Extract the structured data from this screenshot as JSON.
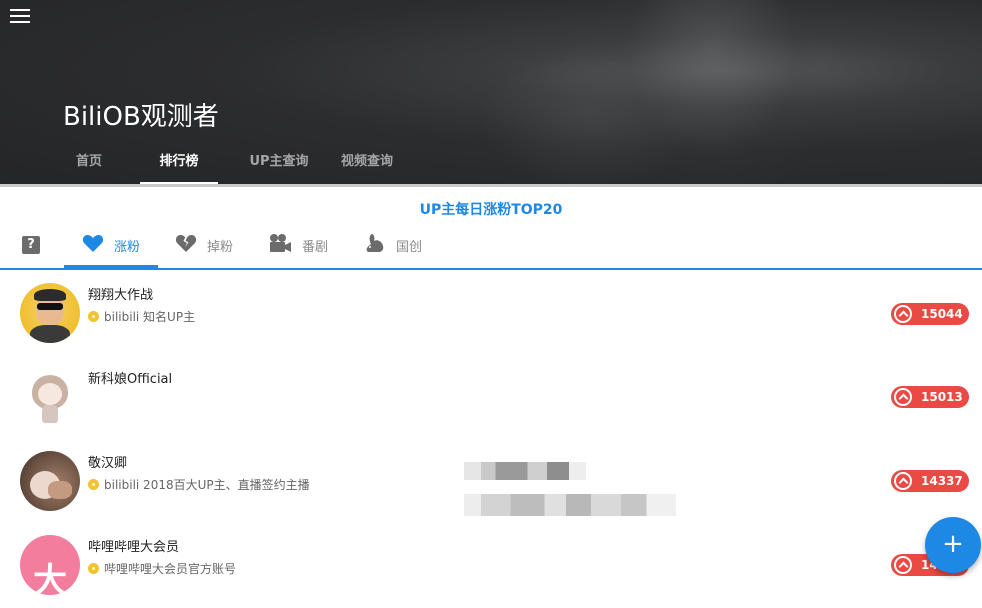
{
  "header": {
    "menu_icon": "menu-icon",
    "title": "BiliOB观测者",
    "nav": [
      {
        "label": "首页",
        "active": false
      },
      {
        "label": "排行榜",
        "active": true
      },
      {
        "label": "UP主查询",
        "active": false
      },
      {
        "label": "视频查询",
        "active": false
      }
    ]
  },
  "section_title": "UP主每日涨粉TOP20",
  "category_tabs": [
    {
      "icon": "help-icon",
      "label": "",
      "active": false
    },
    {
      "icon": "heart-icon",
      "label": "涨粉",
      "active": true
    },
    {
      "icon": "broken-heart-icon",
      "label": "掉粉",
      "active": false
    },
    {
      "icon": "video-camera-icon",
      "label": "番剧",
      "active": false
    },
    {
      "icon": "rabbit-icon",
      "label": "国创",
      "active": false
    }
  ],
  "ranking": [
    {
      "name": "翔翔大作战",
      "verified_text": "bilibili 知名UP主",
      "fans_gain": "15044"
    },
    {
      "name": "新科娘Official",
      "verified_text": "",
      "fans_gain": "15013"
    },
    {
      "name": "敬汉卿",
      "verified_text": "bilibili 2018百大UP主、直播签约主播",
      "fans_gain": "14337"
    },
    {
      "name": "哔哩哔哩大会员",
      "verified_text": "哔哩哔哩大会员官方账号",
      "fans_gain": "14..."
    }
  ],
  "fab": {
    "label": "+",
    "icon": "plus-icon"
  },
  "colors": {
    "accent": "#1e88e5",
    "badge": "#e94a43",
    "verified": "#f2c230"
  }
}
